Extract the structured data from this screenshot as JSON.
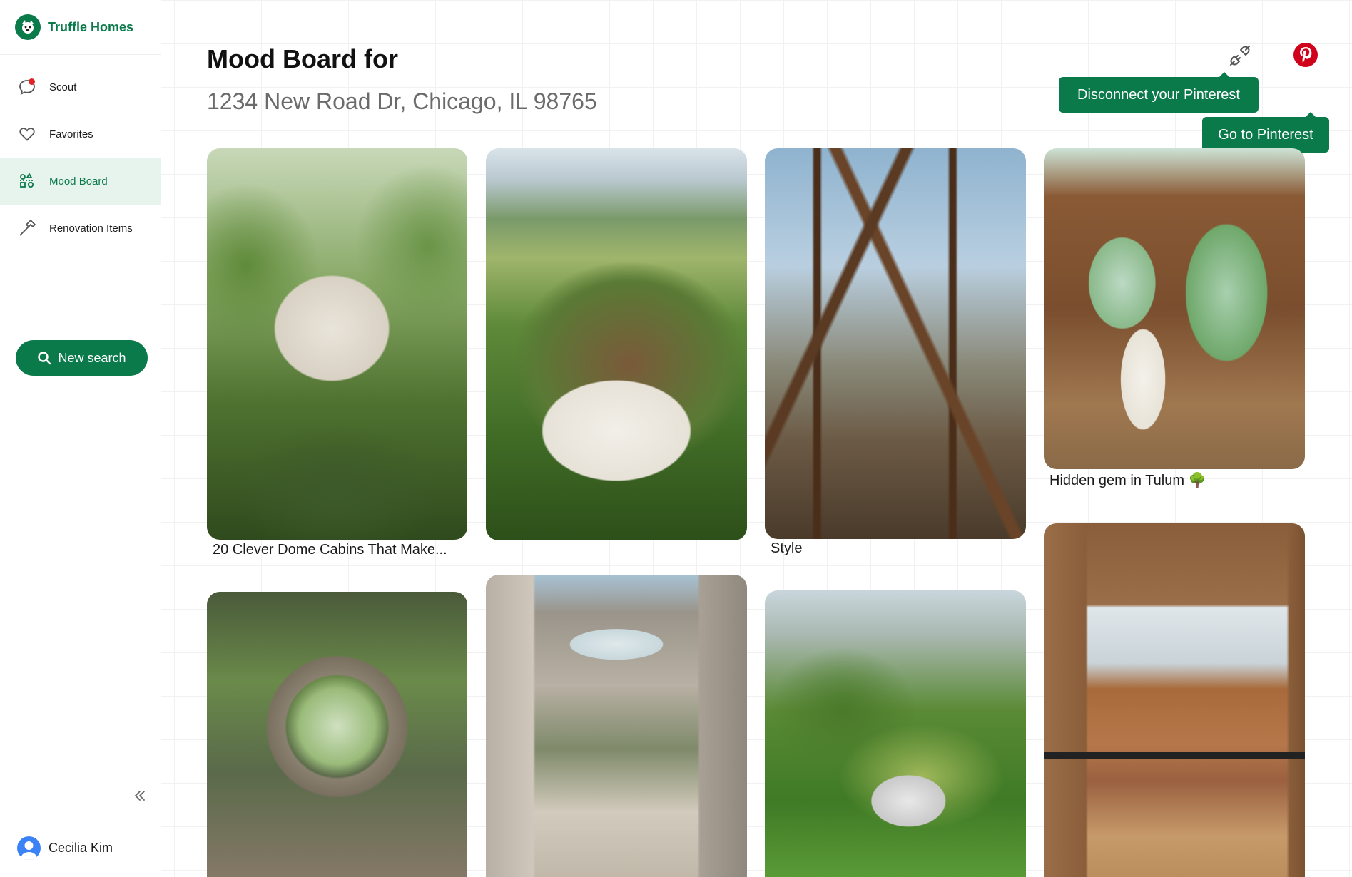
{
  "brand": {
    "name": "Truffle Homes"
  },
  "nav": {
    "items": [
      {
        "label": "Scout",
        "icon": "chat-bubble-icon",
        "active": false,
        "has_notification": true
      },
      {
        "label": "Favorites",
        "icon": "heart-icon",
        "active": false
      },
      {
        "label": "Mood Board",
        "icon": "mood-board-icon",
        "active": true
      },
      {
        "label": "Renovation Items",
        "icon": "hammer-icon",
        "active": false
      }
    ],
    "new_search_label": "New search"
  },
  "user": {
    "name": "Cecilia Kim"
  },
  "header": {
    "title": "Mood Board for",
    "address": "1234 New Road Dr, Chicago, IL 98765"
  },
  "tooltips": {
    "disconnect": "Disconnect your Pinterest",
    "goto": "Go to Pinterest"
  },
  "pins": [
    {
      "caption": "20 Clever Dome Cabins That Make..."
    },
    {
      "caption": ""
    },
    {
      "caption": "Style"
    },
    {
      "caption": "Hidden gem in Tulum 🌳"
    },
    {
      "caption": ""
    },
    {
      "caption": ""
    },
    {
      "caption": ""
    },
    {
      "caption": ""
    }
  ],
  "colors": {
    "brand_green": "#0b7a4b",
    "active_bg": "#e6f4ed",
    "pinterest_red": "#d0021b",
    "notification_red": "#e02424"
  }
}
